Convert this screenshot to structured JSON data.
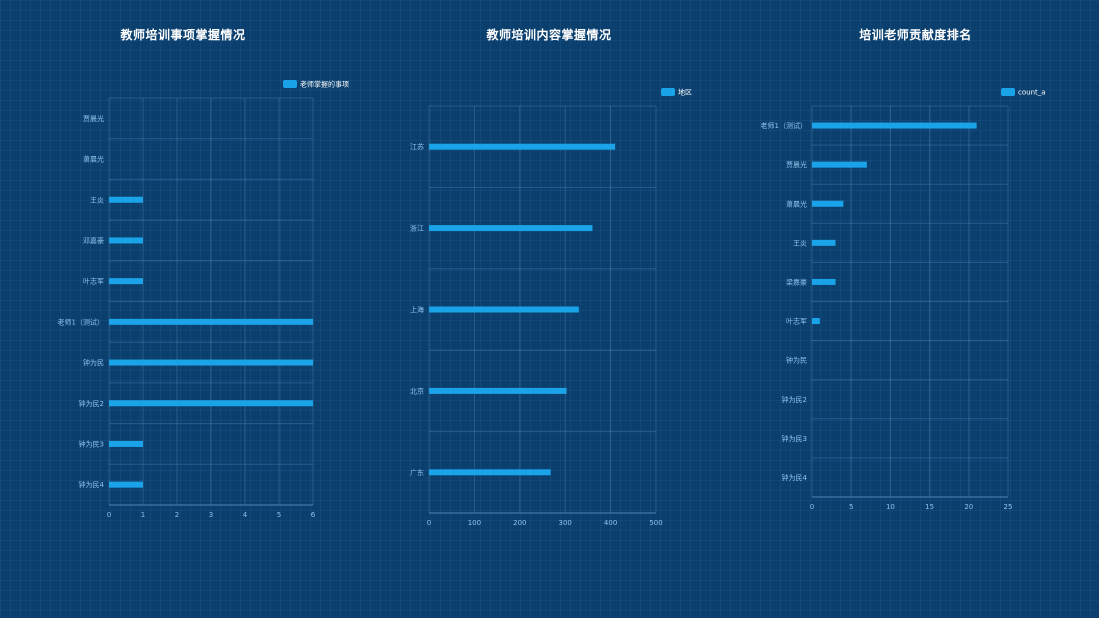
{
  "charts": [
    {
      "title": "教师培训事项掌握情况",
      "chart_data": {
        "type": "bar",
        "orientation": "horizontal",
        "categories": [
          "贾晨光",
          "萧晨光",
          "王炎",
          "邓嘉豪",
          "叶志军",
          "老师1（测试）",
          "钟为民",
          "钟为民2",
          "钟为民3",
          "钟为民4"
        ],
        "series": [
          {
            "name": "老师掌握的事项",
            "values": [
              0,
              0,
              1,
              1,
              1,
              6,
              6,
              6,
              1,
              1
            ]
          }
        ],
        "xlim": [
          0,
          6
        ],
        "xticks": [
          0,
          1,
          2,
          3,
          4,
          5,
          6
        ],
        "grid": true,
        "legend": "top-right",
        "color": "#1aa3e8"
      }
    },
    {
      "title": "教师培训内容掌握情况",
      "chart_data": {
        "type": "bar",
        "orientation": "horizontal",
        "categories": [
          "江苏",
          "浙江",
          "上海",
          "北京",
          "广东"
        ],
        "series": [
          {
            "name": "地区",
            "values": [
              410,
              360,
              330,
              303,
              268
            ]
          }
        ],
        "xlim": [
          0,
          500
        ],
        "xticks": [
          0,
          100,
          200,
          300,
          400,
          500
        ],
        "grid": true,
        "legend": "top-right",
        "color": "#1aa3e8"
      }
    },
    {
      "title": "培训老师贡献度排名",
      "chart_data": {
        "type": "bar",
        "orientation": "horizontal",
        "categories": [
          "老师1（测试）",
          "贾晨光",
          "萧晨光",
          "王炎",
          "梁嘉豪",
          "叶志军",
          "钟为民",
          "钟为民2",
          "钟为民3",
          "钟为民4"
        ],
        "series": [
          {
            "name": "count_a",
            "values": [
              21,
              7,
              4,
              3,
              3,
              1,
              0,
              0,
              0,
              0
            ]
          }
        ],
        "xlim": [
          0,
          25
        ],
        "xticks": [
          0,
          5,
          10,
          15,
          20,
          25
        ],
        "grid": true,
        "legend": "top-right",
        "color": "#1aa3e8"
      }
    }
  ]
}
